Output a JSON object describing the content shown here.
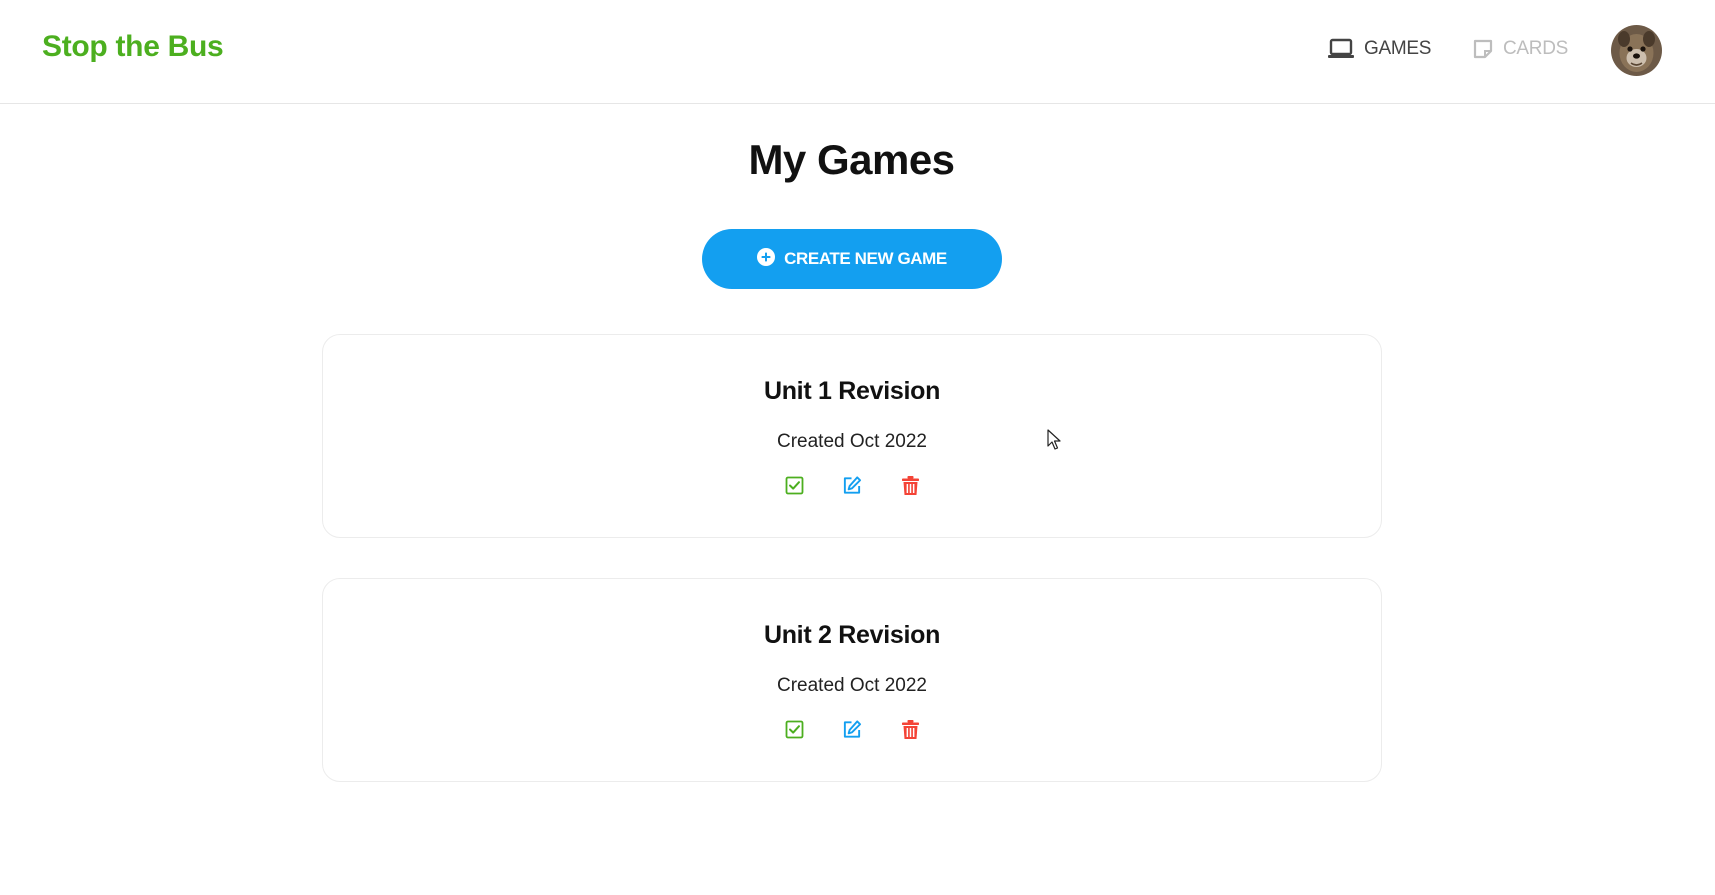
{
  "app": {
    "brand": "Stop the Bus",
    "brand_color": "#4caf1f",
    "accent_color": "#139ff0",
    "danger_color": "#f44336"
  },
  "nav": {
    "games_label": "GAMES",
    "games_icon": "laptop-icon",
    "cards_label": "CARDS",
    "cards_icon": "card-icon"
  },
  "page": {
    "title": "My Games",
    "create_button_label": "CREATE NEW GAME",
    "create_button_icon": "plus-circle-icon"
  },
  "games": [
    {
      "title": "Unit 1 Revision",
      "created": "Created Oct 2022"
    },
    {
      "title": "Unit 2 Revision",
      "created": "Created Oct 2022"
    }
  ],
  "card_actions": [
    {
      "icon": "check-square-icon",
      "color": "#4caf1f"
    },
    {
      "icon": "edit-icon",
      "color": "#139ff0"
    },
    {
      "icon": "trash-icon",
      "color": "#f44336"
    }
  ]
}
